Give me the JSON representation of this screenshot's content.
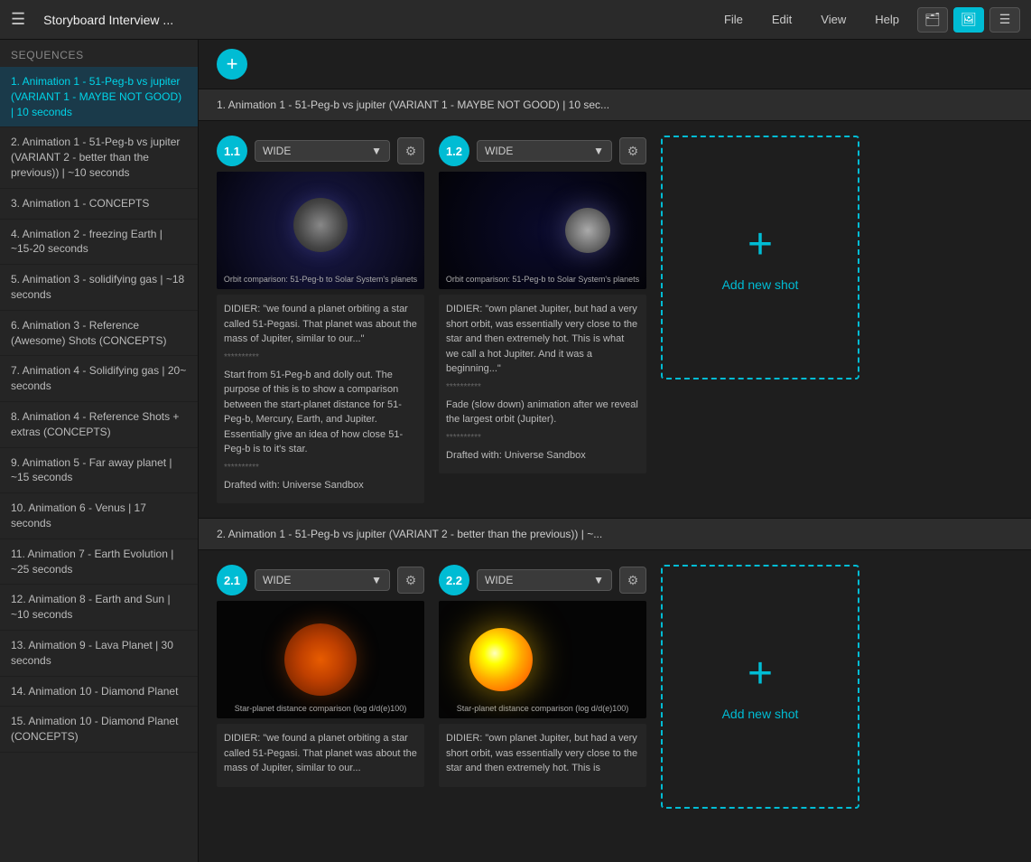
{
  "topbar": {
    "title": "Storyboard Interview ...",
    "menu_items": [
      "File",
      "Edit",
      "View",
      "Help"
    ],
    "btn_briefcase": "📁",
    "btn_image": "🖼",
    "btn_list": "☰"
  },
  "sidebar": {
    "header": "Sequences",
    "items": [
      {
        "id": 1,
        "label": "1. Animation 1 - 51-Peg-b vs jupiter (VARIANT 1 - MAYBE NOT GOOD) | 10 seconds",
        "active": true
      },
      {
        "id": 2,
        "label": "2. Animation 1 - 51-Peg-b vs jupiter (VARIANT 2 - better than the previous)) | ~10 seconds"
      },
      {
        "id": 3,
        "label": "3. Animation 1 - CONCEPTS"
      },
      {
        "id": 4,
        "label": "4. Animation 2 - freezing Earth | ~15-20 seconds"
      },
      {
        "id": 5,
        "label": "5. Animation 3 - solidifying gas | ~18 seconds"
      },
      {
        "id": 6,
        "label": "6. Animation 3 - Reference (Awesome) Shots (CONCEPTS)"
      },
      {
        "id": 7,
        "label": "7. Animation 4 - Solidifying gas | 20~ seconds"
      },
      {
        "id": 8,
        "label": "8. Animation 4 - Reference Shots + extras (CONCEPTS)"
      },
      {
        "id": 9,
        "label": "9. Animation 5 - Far away planet | ~15 seconds"
      },
      {
        "id": 10,
        "label": "10. Animation 6 - Venus | 17 seconds"
      },
      {
        "id": 11,
        "label": "11. Animation 7 - Earth Evolution | ~25 seconds"
      },
      {
        "id": 12,
        "label": "12. Animation 8 - Earth and Sun | ~10 seconds"
      },
      {
        "id": 13,
        "label": "13. Animation 9 - Lava Planet | 30 seconds"
      },
      {
        "id": 14,
        "label": "14. Animation 10 - Diamond Planet"
      },
      {
        "id": 15,
        "label": "15. Animation 10 - Diamond Planet (CONCEPTS)"
      }
    ]
  },
  "sections": [
    {
      "id": "s1",
      "header": "1. Animation 1 - 51-Peg-b vs jupiter (VARIANT 1 - MAYBE NOT GOOD) | 10 sec...",
      "shots": [
        {
          "number": "1.1",
          "dropdown": "WIDE",
          "image_class": "shot-img-11",
          "caption": "Orbit comparison: 51-Peg-b to Solar System's planets",
          "text_lines": [
            "DIDIER: \"we found a planet orbiting a star called 51-Pegasi. That planet was about the mass of Jupiter, similar to our...\"",
            "**********",
            "Start from 51-Peg-b and dolly out. The purpose of this is to show a comparison between the start-planet distance for 51-Peg-b, Mercury, Earth, and Jupiter. Essentially give an idea of how close 51-Peg-b is to it's star.",
            "**********",
            "Drafted with: Universe Sandbox"
          ]
        },
        {
          "number": "1.2",
          "dropdown": "WIDE",
          "image_class": "shot-img-12",
          "caption": "Orbit comparison: 51-Peg-b to Solar System's planets",
          "text_lines": [
            "DIDIER: \"own planet Jupiter, but had a very short orbit, was essentially very close to the star and then extremely hot. This is what we call a hot Jupiter. And it was a beginning...\"",
            "**********",
            "Fade (slow down) animation after we reveal the largest orbit (Jupiter).",
            "**********",
            "Drafted with: Universe Sandbox"
          ]
        }
      ],
      "add_shot_label": "Add new shot"
    },
    {
      "id": "s2",
      "header": "2. Animation 1 - 51-Peg-b vs jupiter (VARIANT 2 - better than the previous)) | ~...",
      "shots": [
        {
          "number": "2.1",
          "dropdown": "WIDE",
          "image_class": "shot-img-21",
          "caption": "Star-planet distance comparison (log d/d(e)100)",
          "text_lines": [
            "DIDIER: \"we found a planet orbiting a star called 51-Pegasi. That planet was about the mass of Jupiter, similar to our..."
          ]
        },
        {
          "number": "2.2",
          "dropdown": "WIDE",
          "image_class": "shot-img-22",
          "caption": "Star-planet distance comparison (log d/d(e)100)",
          "text_lines": [
            "DIDIER: \"own planet Jupiter, but had a very short orbit, was essentially very close to the star and then extremely hot. This is"
          ]
        }
      ],
      "add_shot_label": "Add new shot"
    }
  ]
}
